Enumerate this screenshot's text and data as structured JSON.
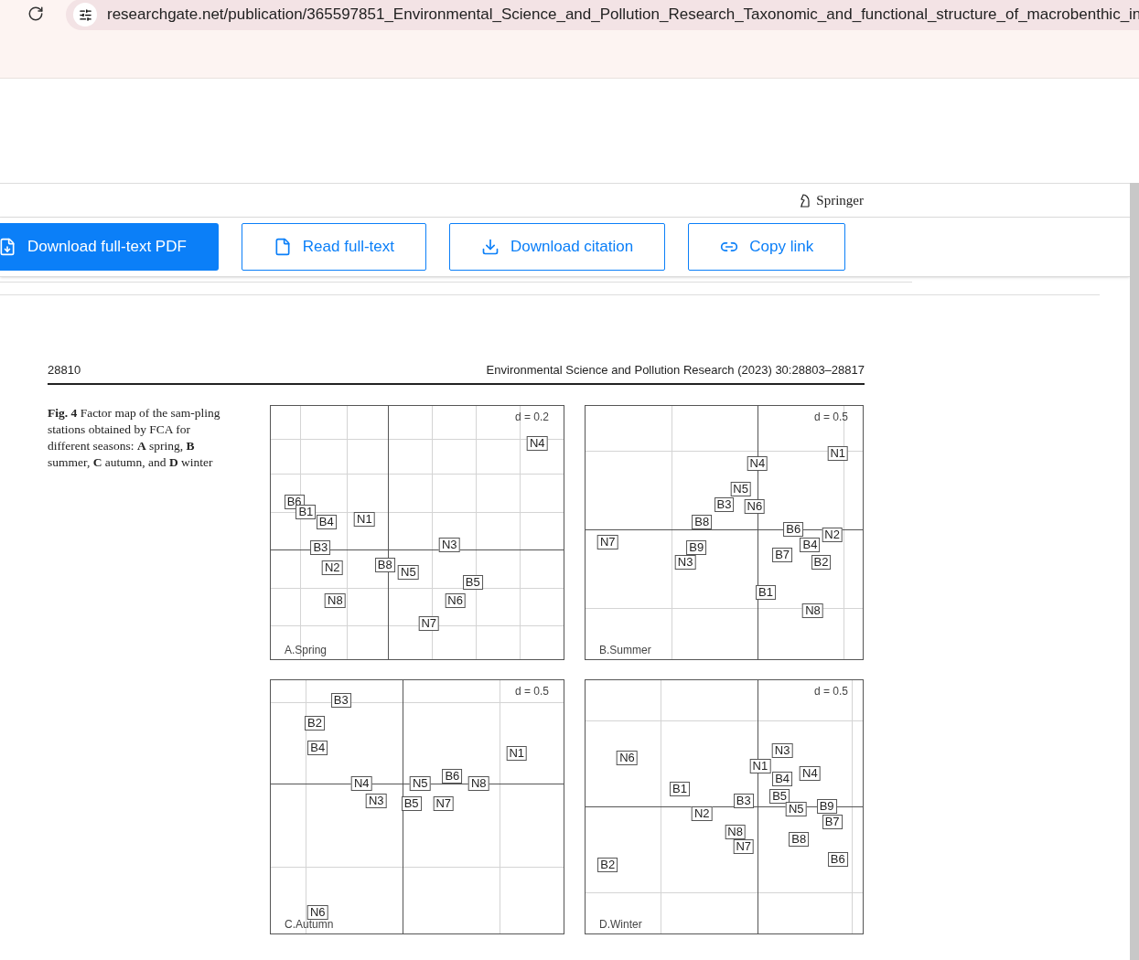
{
  "browser": {
    "url": "researchgate.net/publication/365597851_Environmental_Science_and_Pollution_Research_Taxonomic_and_functional_structure_of_macrobenthic_in"
  },
  "publisher": "Springer",
  "actions": [
    {
      "label": "Download full-text PDF",
      "kind": "primary"
    },
    {
      "label": "Read full-text",
      "kind": "outline"
    },
    {
      "label": "Download citation",
      "kind": "outline"
    },
    {
      "label": "Copy link",
      "kind": "outline"
    }
  ],
  "page": {
    "number": "28810",
    "journal": "Environmental Science and Pollution Research (2023) 30:28803–28817"
  },
  "figure": {
    "caption": "**Fig. 4** Factor map of the sam-pling stations obtained by FCA for different seasons: **A** spring, **B** summer, **C** autumn, and **D** winter",
    "panels": [
      {
        "title": "A.Spring",
        "scale": "d = 0.2",
        "labels": [
          "N4",
          "B6",
          "B1",
          "B4",
          "N1",
          "B3",
          "N2",
          "N8",
          "B8",
          "N5",
          "N3",
          "B5",
          "N6",
          "N7"
        ]
      },
      {
        "title": "B.Summer",
        "scale": "d = 0.5",
        "labels": [
          "N1",
          "N4",
          "N5",
          "B3",
          "N6",
          "B8",
          "N7",
          "B9",
          "N3",
          "B6",
          "N2",
          "B4",
          "B7",
          "B2",
          "B1",
          "N8"
        ]
      },
      {
        "title": "C.Autumn",
        "scale": "d = 0.5",
        "labels": [
          "B3",
          "B2",
          "B4",
          "N1",
          "N4",
          "N5",
          "B6",
          "N8",
          "N3",
          "B5",
          "N7",
          "N6"
        ]
      },
      {
        "title": "D.Winter",
        "scale": "d = 0.5",
        "labels": [
          "N6",
          "B1",
          "N2",
          "B3",
          "N8",
          "N7",
          "N3",
          "N1",
          "B4",
          "N4",
          "B5",
          "N5",
          "B9",
          "B7",
          "B8",
          "B6",
          "B2"
        ]
      }
    ]
  }
}
